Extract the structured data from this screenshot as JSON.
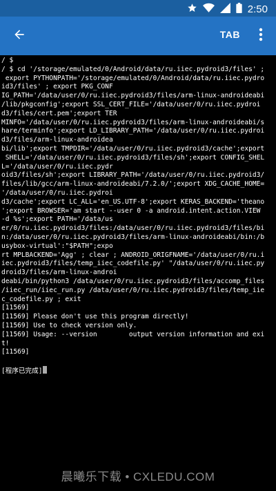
{
  "status_bar": {
    "time": "2:50",
    "icons": [
      "star-icon",
      "wifi-icon",
      "signal-icon",
      "battery-icon"
    ]
  },
  "app_bar": {
    "back_icon": "arrow-left-icon",
    "tab_label": "TAB",
    "more_icon": "more-vertical-icon"
  },
  "colors": {
    "status_bar": "#1b5fa0",
    "app_bar": "#2473c4",
    "terminal_bg": "#000000",
    "terminal_text": "#ffffff"
  },
  "terminal": {
    "lines": [
      "/ $",
      "/ $ cd '/storage/emulated/0/Android/data/ru.iiec.pydroid3/files' ;",
      " export PYTHONPATH='/storage/emulated/0/Android/data/ru.iiec.pydro",
      "id3/files' ; export PKG_CONF",
      "IG_PATH='/data/user/0/ru.iiec.pydroid3/files/arm-linux-androideabi",
      "/lib/pkgconfig';export SSL_CERT_FILE='/data/user/0/ru.iiec.pydroi",
      "d3/files/cert.pem';export TER",
      "MINFO='/data/user/0/ru.iiec.pydroid3/files/arm-linux-androideabi/s",
      "hare/terminfo';export LD_LIBRARY_PATH='/data/user/0/ru.iiec.pydroi",
      "d3/files/arm-linux-androidea",
      "bi/lib';export TMPDIR='/data/user/0/ru.iiec.pydroid3/cache';export",
      " SHELL='/data/user/0/ru.iiec.pydroid3/files/sh';export CONFIG_SHEL",
      "L='/data/user/0/ru.iiec.pydr",
      "oid3/files/sh';export LIBRARY_PATH='/data/user/0/ru.iiec.pydroid3/",
      "files/lib/gcc/arm-linux-androideabi/7.2.0/';export XDG_CACHE_HOME=",
      "'/data/user/0/ru.iiec.pydroi",
      "d3/cache';export LC_ALL='en_US.UTF-8';export KERAS_BACKEND='theano",
      "';export BROWSER='am start --user 0 -a android.intent.action.VIEW",
      "-d %s';export PATH='/data/us",
      "er/0/ru.iiec.pydroid3/files:/data/user/0/ru.iiec.pydroid3/files/bi",
      "n:/data/user/0/ru.iiec.pydroid3/files/arm-linux-androideabi/bin:/b",
      "usybox-virtual':\"$PATH\";expo",
      "rt MPLBACKEND='Agg' ; clear ; ANDROID_ORIGFNAME='/data/user/0/ru.i",
      "iec.pydroid3/files/temp_iiec_codefile.py' \"/data/user/0/ru.iiec.py",
      "droid3/files/arm-linux-androi",
      "deabi/bin/python3 /data/user/0/ru.iiec.pydroid3/files/accomp_files",
      "/iiec_run/iiec_run.py /data/user/0/ru.iiec.pydroid3/files/temp_iie",
      "c_codefile.py ; exit",
      "[11569]",
      "[11569] Please don't use this program directly!",
      "[11569] Use to check version only.",
      "[11569] Usage: --version        output version information and exi",
      "t!",
      "[11569]",
      "",
      "[程序已完成]"
    ]
  },
  "watermark": {
    "text": "晨曦乐下载 • CXLEDU.COM"
  }
}
